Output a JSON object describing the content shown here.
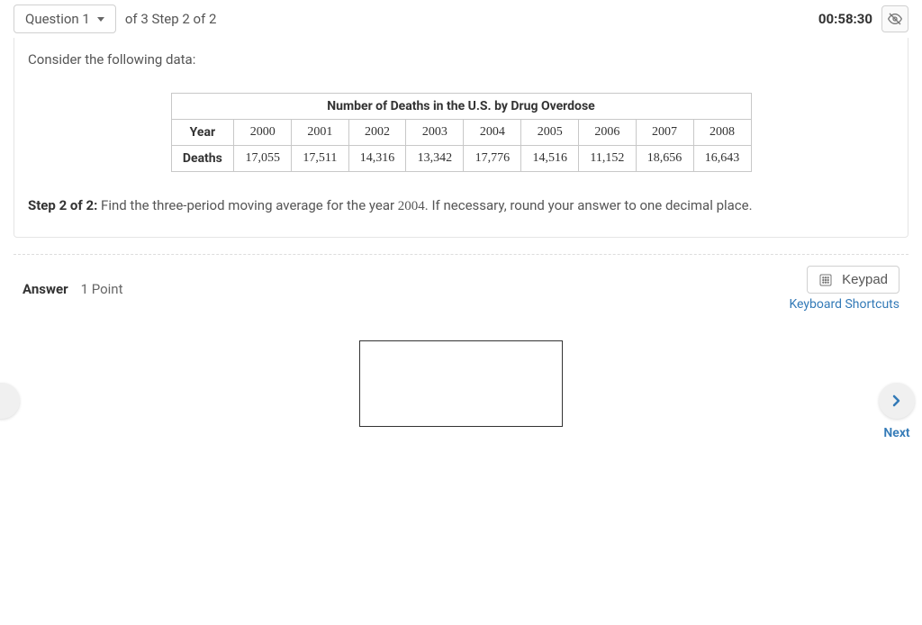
{
  "header": {
    "question_label": "Question 1",
    "step_text": "of 3 Step 2 of 2",
    "timer": "00:58:30"
  },
  "content": {
    "intro": "Consider the following data:",
    "table_title": "Number of Deaths in the U.S. by Drug Overdose",
    "year_header": "Year",
    "deaths_header": "Deaths",
    "years": [
      "2000",
      "2001",
      "2002",
      "2003",
      "2004",
      "2005",
      "2006",
      "2007",
      "2008"
    ],
    "deaths": [
      "17,055",
      "17,511",
      "14,316",
      "13,342",
      "17,776",
      "14,516",
      "11,152",
      "18,656",
      "16,643"
    ],
    "step_label": "Step 2 of 2:",
    "instruction_pre": " Find the three-period moving average for the year ",
    "instruction_year": "2004",
    "instruction_post": ". If necessary, round your answer to one decimal place."
  },
  "answer": {
    "label": "Answer",
    "points": "1 Point",
    "keypad_label": "Keypad",
    "shortcuts_label": "Keyboard Shortcuts",
    "input_value": ""
  },
  "nav": {
    "next_label": "Next"
  },
  "chart_data": {
    "type": "table",
    "title": "Number of Deaths in the U.S. by Drug Overdose",
    "categories": [
      "2000",
      "2001",
      "2002",
      "2003",
      "2004",
      "2005",
      "2006",
      "2007",
      "2008"
    ],
    "series": [
      {
        "name": "Deaths",
        "values": [
          17055,
          17511,
          14316,
          13342,
          17776,
          14516,
          11152,
          18656,
          16643
        ]
      }
    ]
  }
}
